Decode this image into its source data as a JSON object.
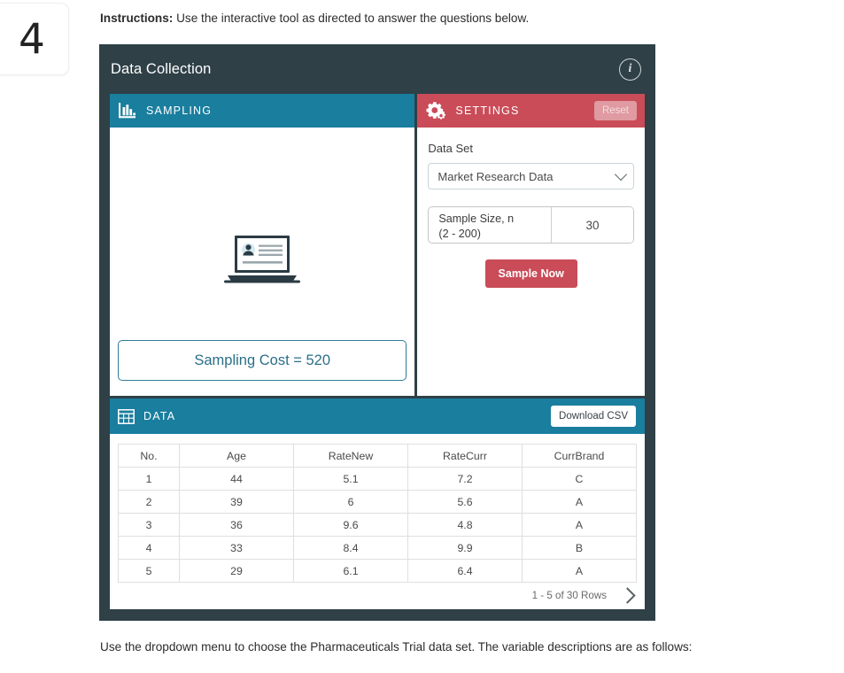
{
  "question_number": "4",
  "instructions": {
    "label": "Instructions:",
    "text": " Use the interactive tool as directed to answer the questions below."
  },
  "widget": {
    "title": "Data Collection",
    "info_icon": "info-icon",
    "sampling": {
      "header": "SAMPLING",
      "icon": "bar-chart-icon",
      "illustration": "laptop-profile-card-illustration",
      "cost_text": "Sampling Cost = 520"
    },
    "settings": {
      "header": "SETTINGS",
      "icon": "gears-icon",
      "reset_label": "Reset",
      "dataset_label": "Data Set",
      "dataset_value": "Market Research Data",
      "dataset_options": [
        "Market Research Data"
      ],
      "sample_size_label_line1": "Sample Size, n",
      "sample_size_label_line2": "(2 - 200)",
      "sample_size_value": "30",
      "sample_now_label": "Sample Now"
    },
    "data": {
      "header": "DATA",
      "icon": "grid-icon",
      "download_label": "Download CSV",
      "columns": [
        "No.",
        "Age",
        "RateNew",
        "RateCurr",
        "CurrBrand"
      ],
      "rows": [
        [
          "1",
          "44",
          "5.1",
          "7.2",
          "C"
        ],
        [
          "2",
          "39",
          "6",
          "5.6",
          "A"
        ],
        [
          "3",
          "36",
          "9.6",
          "4.8",
          "A"
        ],
        [
          "4",
          "33",
          "8.4",
          "9.9",
          "B"
        ],
        [
          "5",
          "29",
          "6.1",
          "6.4",
          "A"
        ]
      ],
      "pagination_text": "1 - 5 of 30 Rows",
      "next_icon": "chevron-right-icon"
    }
  },
  "trailing_text": "Use the dropdown menu to choose the Pharmaceuticals Trial data set. The variable descriptions are as follows:",
  "colors": {
    "dark_frame": "#2f4047",
    "teal": "#1a7e9e",
    "red": "#c94c58",
    "reset_pink": "#e09aa1",
    "cost_text": "#2a6f88"
  }
}
